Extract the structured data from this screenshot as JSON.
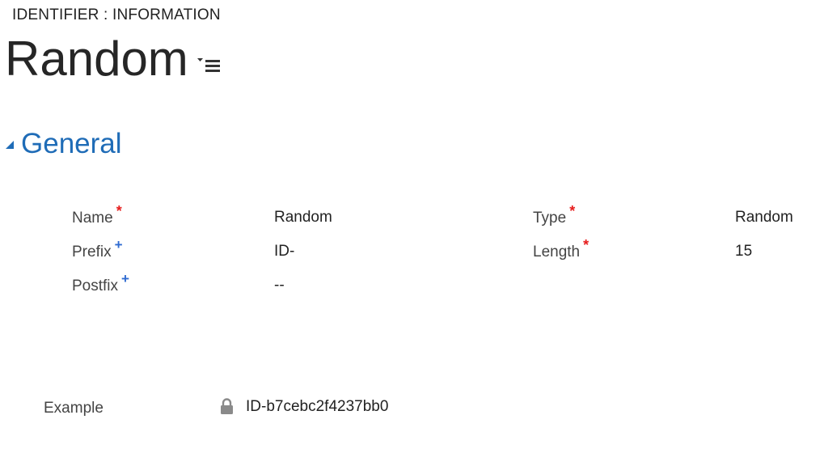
{
  "header": {
    "entity_label": "IDENTIFIER : INFORMATION",
    "record_title": "Random",
    "menu_icon": "list-menu-icon"
  },
  "section": {
    "title": "General",
    "toggle_icon": "collapse-triangle-icon"
  },
  "fields": {
    "name": {
      "label": "Name",
      "marker": "*",
      "value": "Random"
    },
    "prefix": {
      "label": "Prefix",
      "marker": "+",
      "value": "ID-"
    },
    "postfix": {
      "label": "Postfix",
      "marker": "+",
      "value": "--"
    },
    "type": {
      "label": "Type",
      "marker": "*",
      "value": "Random"
    },
    "length": {
      "label": "Length",
      "marker": "*",
      "value": "15"
    }
  },
  "example": {
    "label": "Example",
    "value": "ID-b7cebc2f4237bb0",
    "icon": "lock-icon"
  },
  "colors": {
    "required": "#e61d1d",
    "recommended": "#2f6bd1",
    "section_title": "#1f6cb7"
  }
}
